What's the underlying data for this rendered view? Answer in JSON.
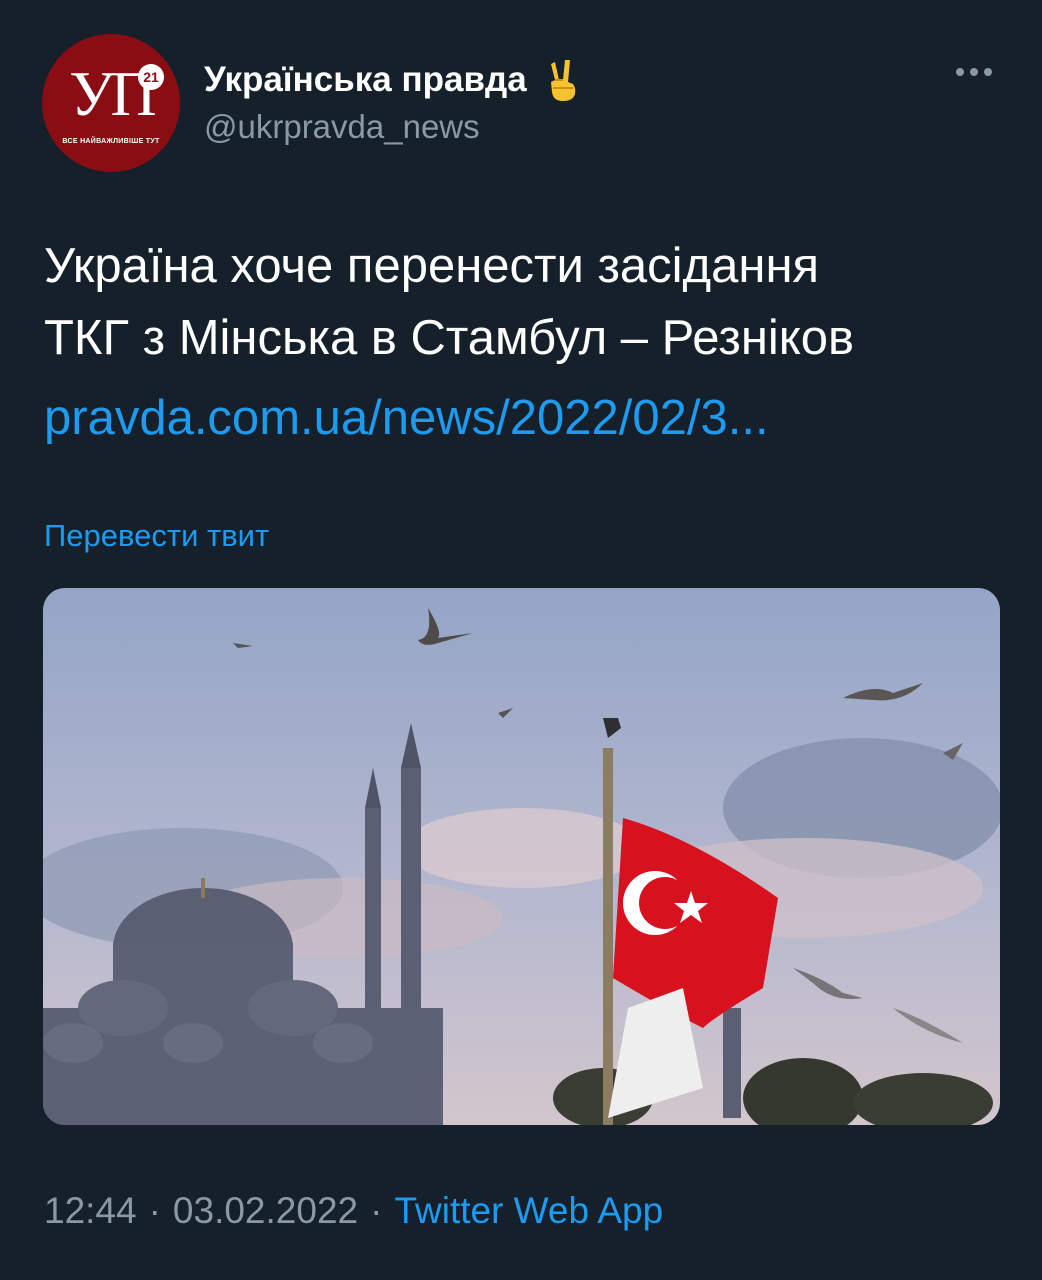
{
  "header": {
    "avatar": {
      "logo_text": "УП",
      "badge": "21",
      "slogan": "ВСЕ НАЙВАЖЛИВІШЕ ТУТ"
    },
    "display_name": "Українська правда",
    "handle": "@ukrpravda_news",
    "verified_emoji_icon": "victory-hand-icon",
    "more_icon": "more-dots-icon"
  },
  "tweet": {
    "line1": "Україна хоче перенести засідання",
    "line2": "ТКГ з Мінська в Стамбул – Резніков",
    "link": "pravda.com.ua/news/2022/02/3...",
    "translate_label": "Перевести твит"
  },
  "photo": {
    "sky_top": "#9aa9c7",
    "sky_bottom": "#c9c4cf",
    "flag_color": "#d8111e",
    "mosque_color": "#5a5f73"
  },
  "meta": {
    "time": "12:44",
    "date": "03.02.2022",
    "separator": "·",
    "source": "Twitter Web App"
  },
  "colors": {
    "background": "#15202b",
    "link": "#1d9bf0",
    "secondary": "#8b98a5"
  }
}
